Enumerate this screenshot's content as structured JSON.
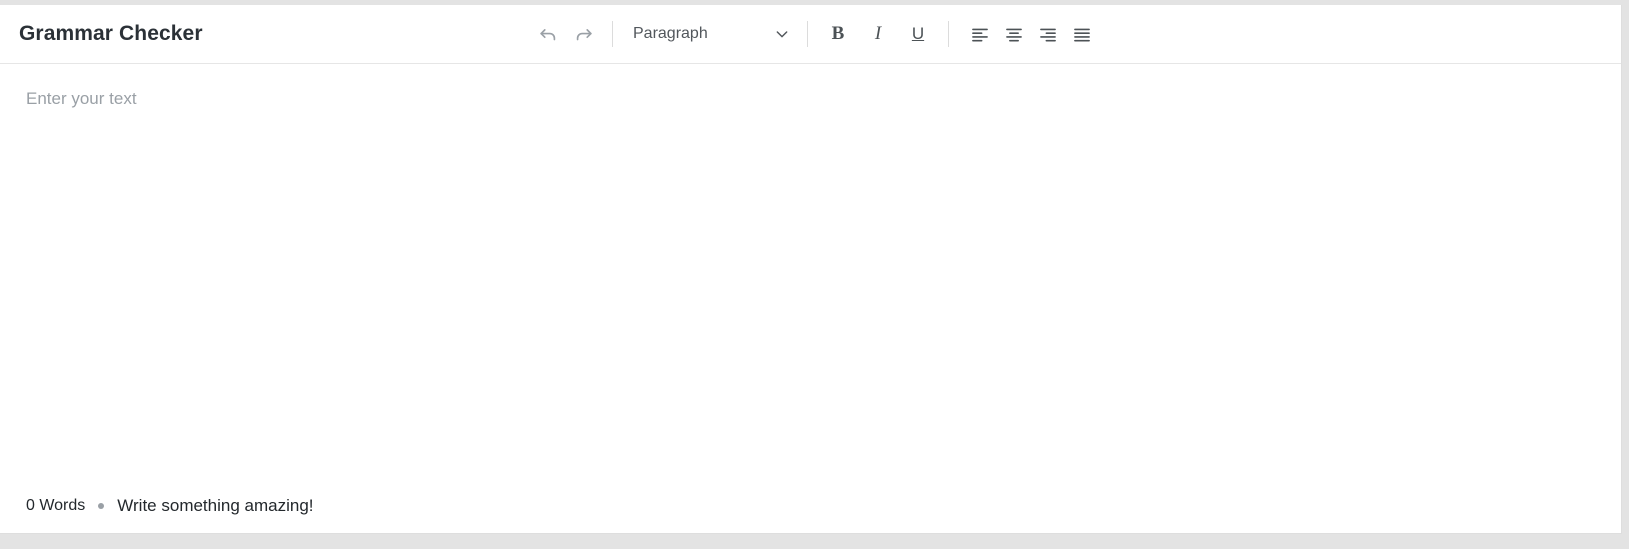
{
  "header": {
    "title": "Grammar Checker"
  },
  "toolbar": {
    "undo": {
      "label": "Undo",
      "icon": "undo-icon"
    },
    "redo": {
      "label": "Redo",
      "icon": "redo-icon"
    },
    "block_style": {
      "selected": "Paragraph",
      "caret_icon": "chevron-down-icon",
      "options": [
        "Paragraph"
      ]
    },
    "bold": {
      "label": "B",
      "icon": "bold-icon"
    },
    "italic": {
      "label": "I",
      "icon": "italic-icon"
    },
    "underline": {
      "label": "U",
      "icon": "underline-icon"
    },
    "align_left": {
      "label": "Align left",
      "icon": "align-left-icon"
    },
    "align_center": {
      "label": "Align center",
      "icon": "align-center-icon"
    },
    "align_right": {
      "label": "Align right",
      "icon": "align-right-icon"
    },
    "align_justify": {
      "label": "Justify",
      "icon": "align-justify-icon"
    }
  },
  "editor": {
    "placeholder": "Enter your text",
    "value": ""
  },
  "footer": {
    "word_count": "0 Words",
    "message": "Write something amazing!"
  },
  "colors": {
    "page_background": "#e3e3e3",
    "card_background": "#ffffff",
    "title_text": "#2b3137",
    "toolbar_icon": "#4c5256",
    "muted_icon": "#9aa0a6",
    "placeholder_text": "#9aa0a6",
    "footer_text": "#23282c",
    "divider": "#e6e6e6"
  }
}
